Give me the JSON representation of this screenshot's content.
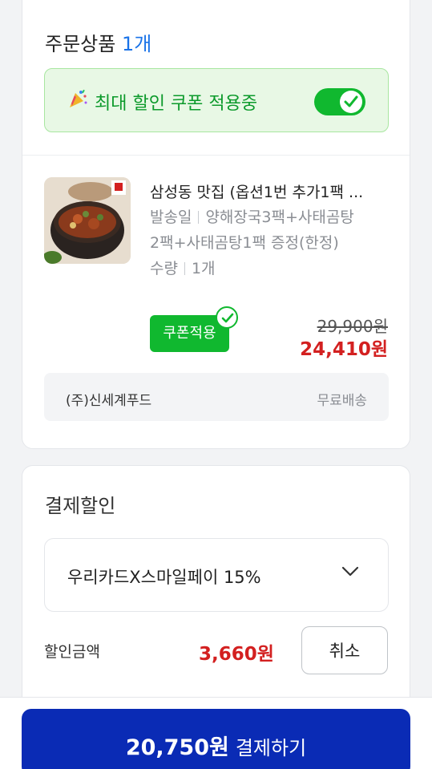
{
  "order": {
    "title": "주문상품",
    "count": "1개",
    "coupon_banner": {
      "icon": "party-popper-icon",
      "text": "최대 할인 쿠폰 적용중",
      "toggle_on": true
    }
  },
  "product": {
    "image": "stew-pot-image",
    "name": "삼성동 맛집 (옵션1번 추가1팩 ...",
    "ship_label": "발송일",
    "ship_value": "양해장국3팩+사태곰탕",
    "ship_value_cont": "2팩+사태곰탕1팩 증정(한정)",
    "qty_label": "수량",
    "qty_value": "1개",
    "coupon_badge": "쿠폰적용",
    "original_price": "29,900원",
    "sale_price": "24,410원"
  },
  "seller": {
    "name": "(주)신세계푸드",
    "shipping": "무료배송"
  },
  "payment_discount": {
    "title": "결제할인",
    "selected_card": "우리카드X스마일페이 15%",
    "discount_label": "할인금액",
    "discount_amount": "3,660원",
    "cancel_label": "취소"
  },
  "checkout": {
    "amount": "20,750원",
    "label": "결제하기"
  },
  "colors": {
    "accent_blue": "#1a73e8",
    "coupon_green": "#10b82f",
    "price_red": "#d32020",
    "pay_button": "#0a2bb5"
  }
}
